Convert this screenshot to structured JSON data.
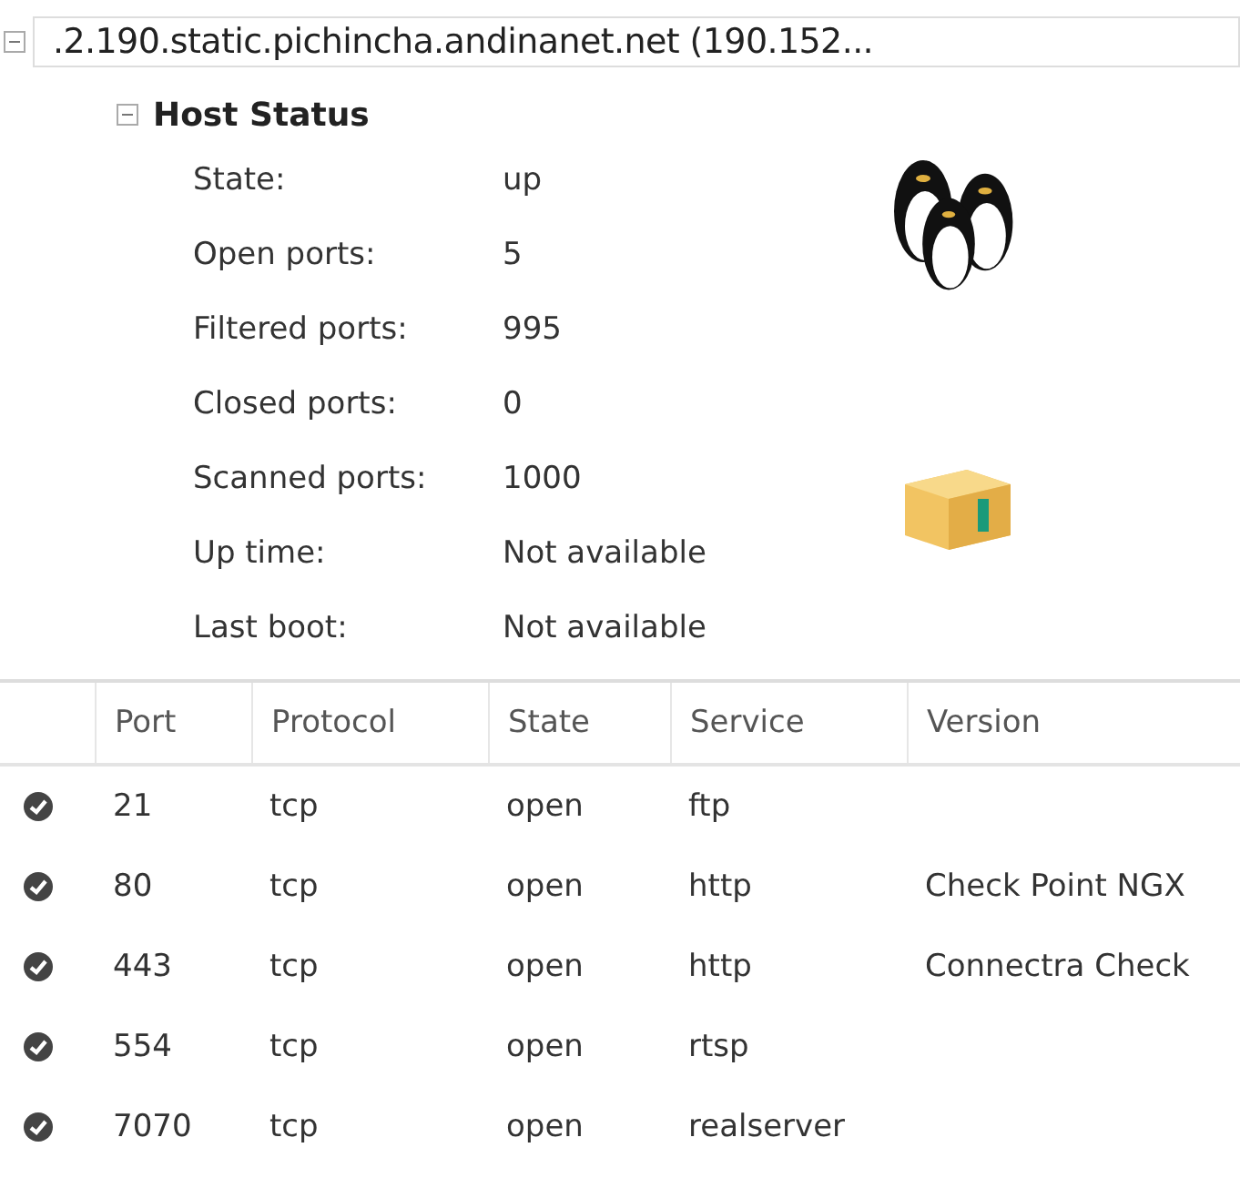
{
  "host": {
    "title": ".2.190.static.pichincha.andinanet.net (190.152...",
    "expanded": true
  },
  "host_status": {
    "title": "Host Status",
    "expanded": true,
    "fields": [
      {
        "label": "State:",
        "value": "up"
      },
      {
        "label": "Open ports:",
        "value": "5"
      },
      {
        "label": "Filtered ports:",
        "value": "995"
      },
      {
        "label": "Closed ports:",
        "value": "0"
      },
      {
        "label": "Scanned ports:",
        "value": "1000"
      },
      {
        "label": "Up time:",
        "value": "Not available"
      },
      {
        "label": "Last boot:",
        "value": "Not available"
      }
    ]
  },
  "ports_table": {
    "columns": [
      "Port",
      "Protocol",
      "State",
      "Service",
      "Version"
    ],
    "rows": [
      {
        "open": true,
        "cells": [
          "21",
          "tcp",
          "open",
          "ftp",
          ""
        ]
      },
      {
        "open": true,
        "cells": [
          "80",
          "tcp",
          "open",
          "http",
          "Check Point NGX"
        ]
      },
      {
        "open": true,
        "cells": [
          "443",
          "tcp",
          "open",
          "http",
          "Connectra Check"
        ]
      },
      {
        "open": true,
        "cells": [
          "554",
          "tcp",
          "open",
          "rtsp",
          ""
        ]
      },
      {
        "open": true,
        "cells": [
          "7070",
          "tcp",
          "open",
          "realserver",
          ""
        ]
      }
    ]
  }
}
